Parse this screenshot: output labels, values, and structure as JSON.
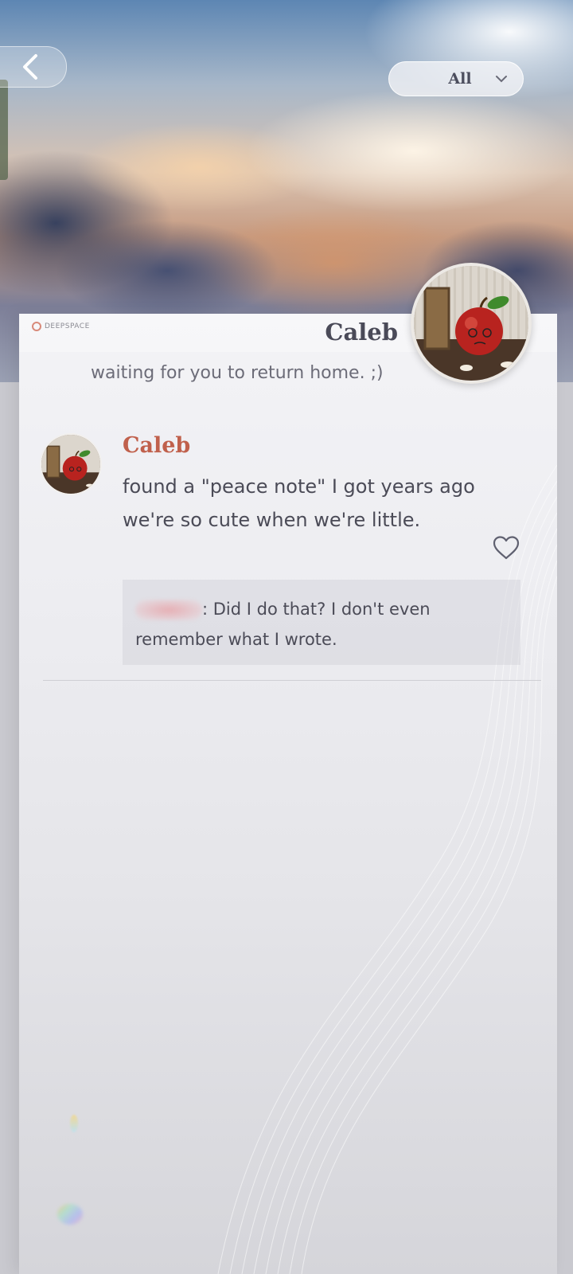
{
  "header": {
    "back_icon": "chevron-left-icon",
    "filter": {
      "selected": "All",
      "icon": "chevron-down-icon"
    }
  },
  "profile": {
    "brand": "DEEPSPACE",
    "name": "Caleb",
    "status": "waiting for you to return home. ;)",
    "avatar": "apple-photo"
  },
  "post": {
    "author": "Caleb",
    "text_lines": [
      "found a \"peace note\" I got years ago",
      "we're so cute when we're little."
    ],
    "like_icon": "heart-outline-icon",
    "comment": {
      "author": "",
      "text": ": Did I do that? I don't even remember what I wrote."
    }
  },
  "colors": {
    "author_name": "#c0604c",
    "body_text": "#4b4b57"
  }
}
